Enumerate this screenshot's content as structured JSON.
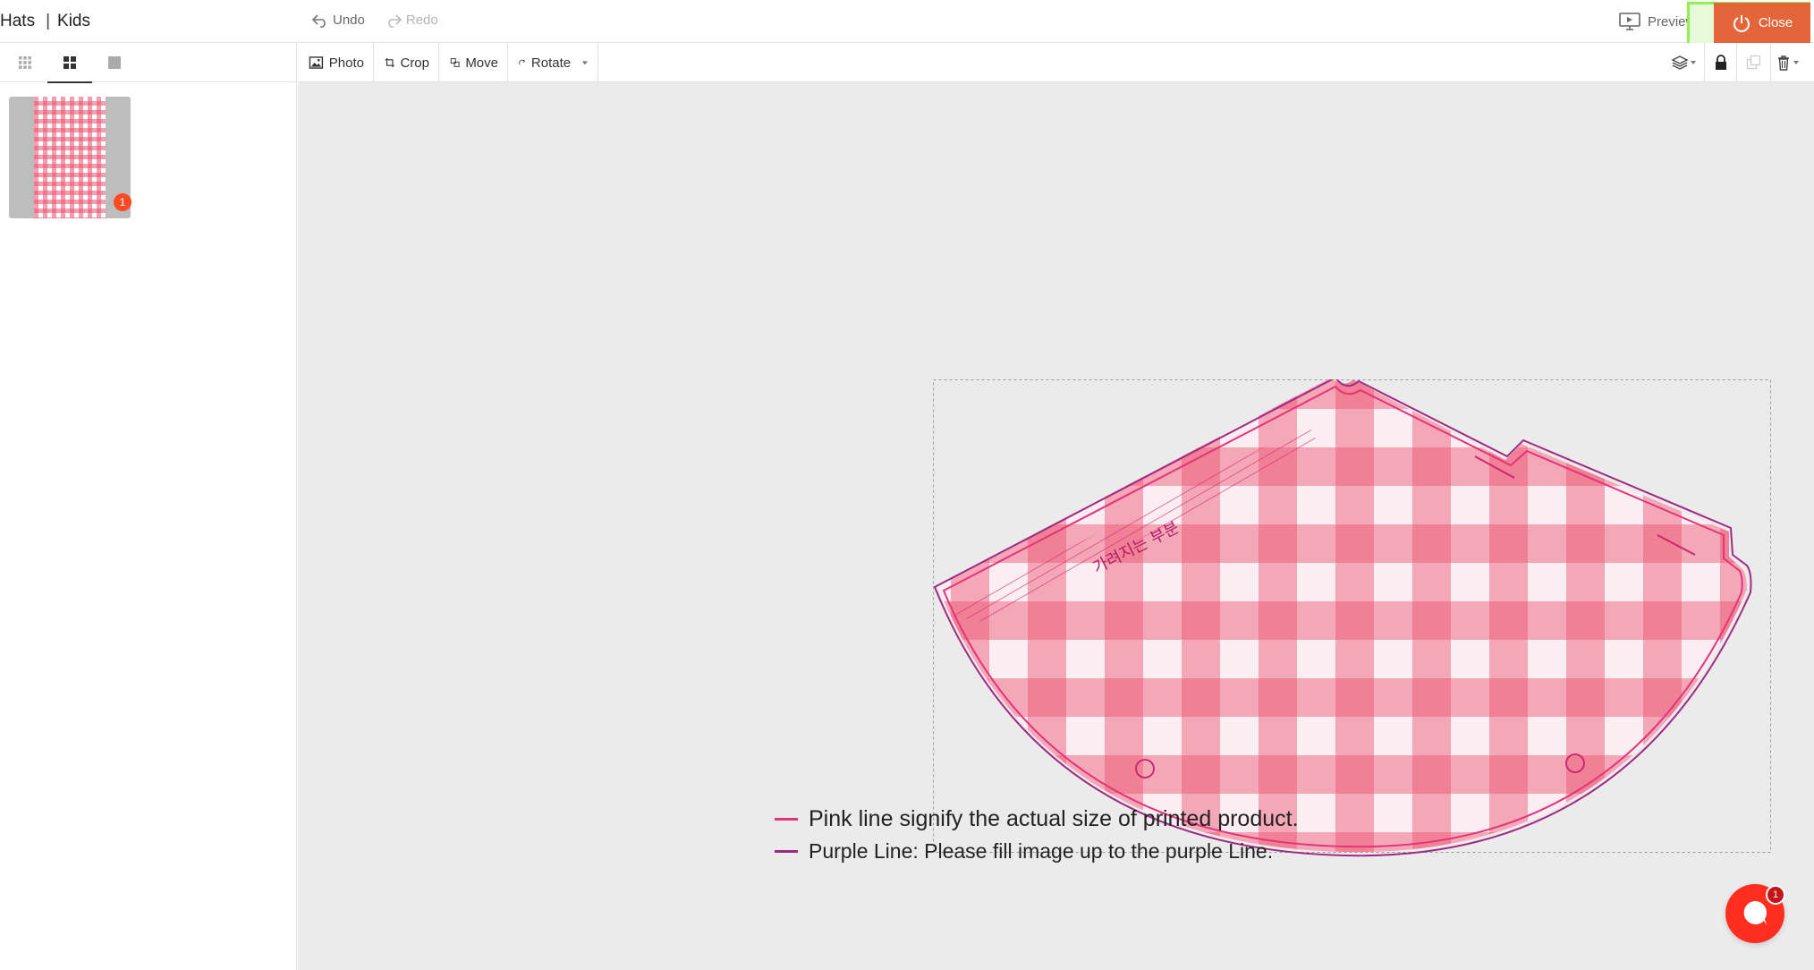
{
  "header": {
    "title_part1": "Hats",
    "title_separator": "|",
    "title_part2": "Kids",
    "undo_label": "Undo",
    "redo_label": "Redo",
    "preview_label": "Preview",
    "close_label": "Close"
  },
  "left_panel": {
    "thumbnails": [
      {
        "badge": "1"
      }
    ]
  },
  "toolbar": {
    "photo_label": "Photo",
    "crop_label": "Crop",
    "move_label": "Move",
    "rotate_label": "Rotate"
  },
  "canvas": {
    "template_text": "가려지는 부분",
    "legend": [
      {
        "text": "Pink line signify the actual size of printed product.",
        "color": "#e5337a"
      },
      {
        "text": "Purple Line: Please fill image up to the purple Line.",
        "color": "#9b2a7e"
      }
    ]
  },
  "chat": {
    "badge": "1"
  },
  "colors": {
    "accent_close": "#e3663b",
    "highlight": "#8ef34a",
    "pattern_pink": "#ec506e",
    "chat": "#ff2e1f"
  }
}
